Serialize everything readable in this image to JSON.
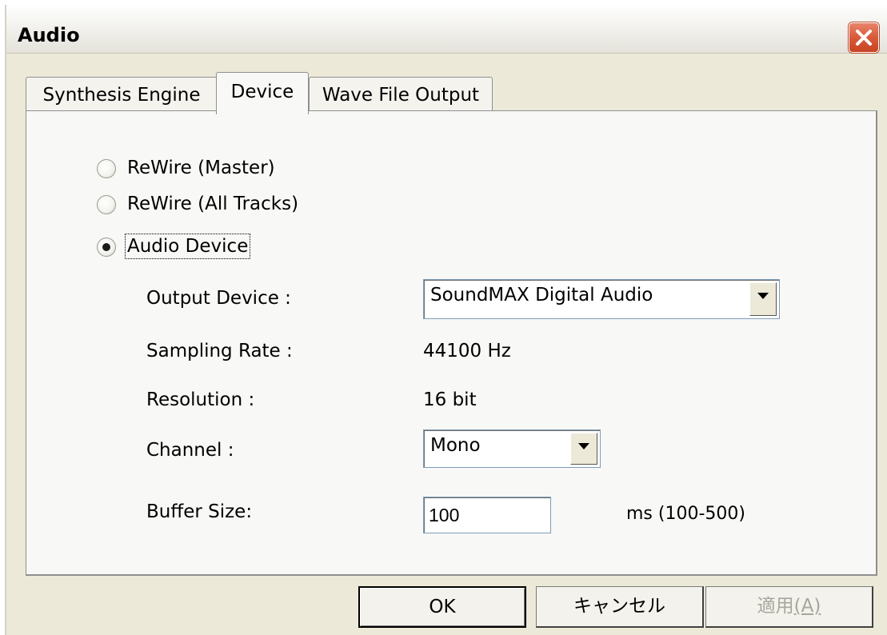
{
  "window": {
    "title": "Audio"
  },
  "tabs": [
    {
      "label": "Synthesis Engine",
      "selected": false
    },
    {
      "label": "Device",
      "selected": true
    },
    {
      "label": "Wave File Output",
      "selected": false
    }
  ],
  "device": {
    "radios": [
      {
        "label": "ReWire (Master)",
        "checked": false
      },
      {
        "label": "ReWire (All Tracks)",
        "checked": false
      },
      {
        "label": "Audio Device",
        "checked": true
      }
    ],
    "output_device": {
      "label": "Output Device :",
      "value": "SoundMAX Digital Audio"
    },
    "sampling_rate": {
      "label": "Sampling Rate :",
      "value": "44100 Hz"
    },
    "resolution": {
      "label": "Resolution :",
      "value": "16 bit"
    },
    "channel": {
      "label": "Channel :",
      "value": "Mono"
    },
    "buffer_size": {
      "label": "Buffer Size:",
      "value": "100",
      "unit": "ms (100-500)"
    }
  },
  "buttons": {
    "ok": "OK",
    "cancel": "キャンセル",
    "apply": "適用",
    "apply_accel": "(A)"
  }
}
